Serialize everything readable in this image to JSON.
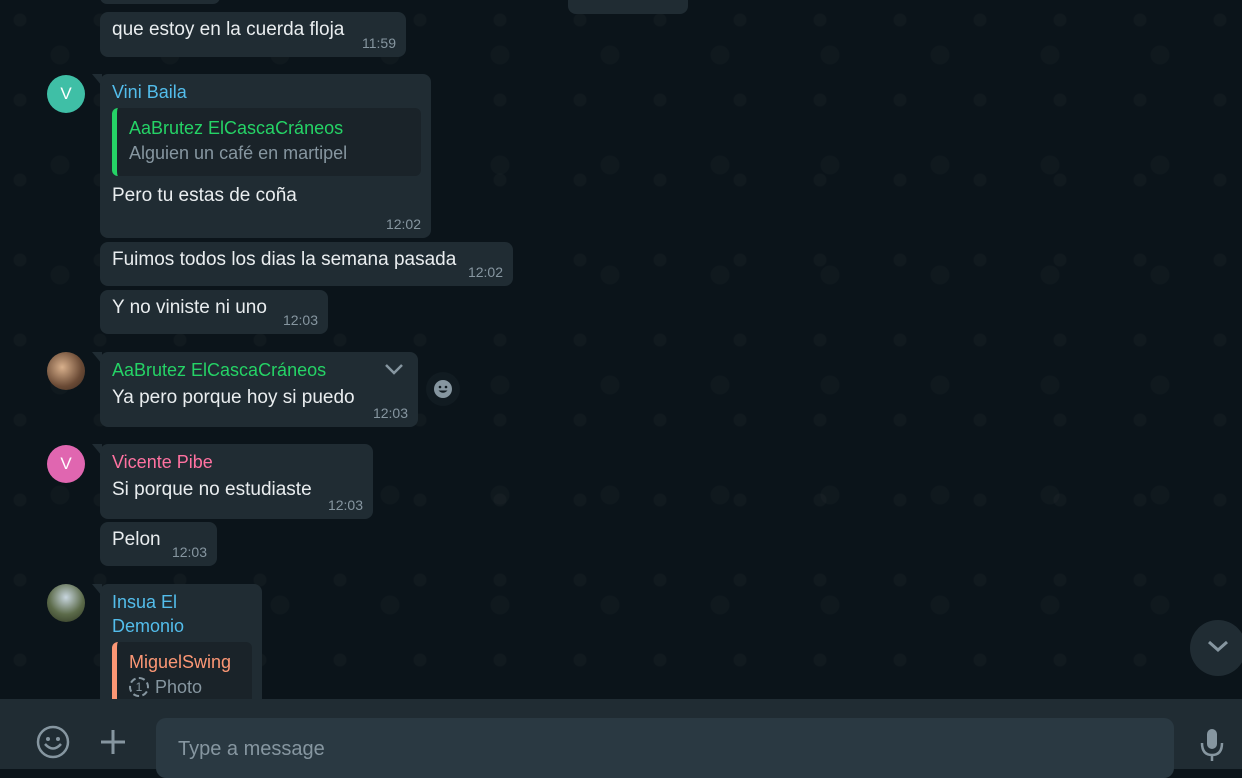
{
  "colors": {
    "bg": "#0b141a",
    "bubble": "#202c33",
    "vini": "#53bdeb",
    "aabrutez": "#25d366",
    "vicente": "#ff72a1",
    "insua": "#53bdeb",
    "miguel": "#fc9775"
  },
  "messages": [
    {
      "text": "que estoy en la cuerda floja",
      "time": "11:59"
    },
    {
      "sender": "Vini Baila",
      "quote_name": "AaBrutez ElCascaCráneos",
      "quote_text": "Alguien un café en martipel",
      "text": "Pero tu estas de coña",
      "time": "12:02",
      "avatar": "V"
    },
    {
      "text": "Fuimos todos los dias la semana pasada",
      "time": "12:02"
    },
    {
      "text": "Y no viniste ni uno",
      "time": "12:03"
    },
    {
      "sender": "AaBrutez ElCascaCráneos",
      "text": "Ya pero porque hoy si puedo",
      "time": "12:03"
    },
    {
      "sender": "Vicente Pibe",
      "text": "Si porque no estudiaste",
      "time": "12:03",
      "avatar": "V"
    },
    {
      "text": "Pelon",
      "time": "12:03"
    },
    {
      "sender": "Insua El Demonio",
      "quote_name": "MiguelSwing",
      "quote_text": "Photo",
      "quote_icon": "1"
    }
  ],
  "input": {
    "placeholder": "Type a message"
  },
  "icons": [
    "emoji-icon",
    "plus-icon",
    "microphone-icon",
    "chevron-down-icon",
    "smiley-reaction-icon"
  ]
}
